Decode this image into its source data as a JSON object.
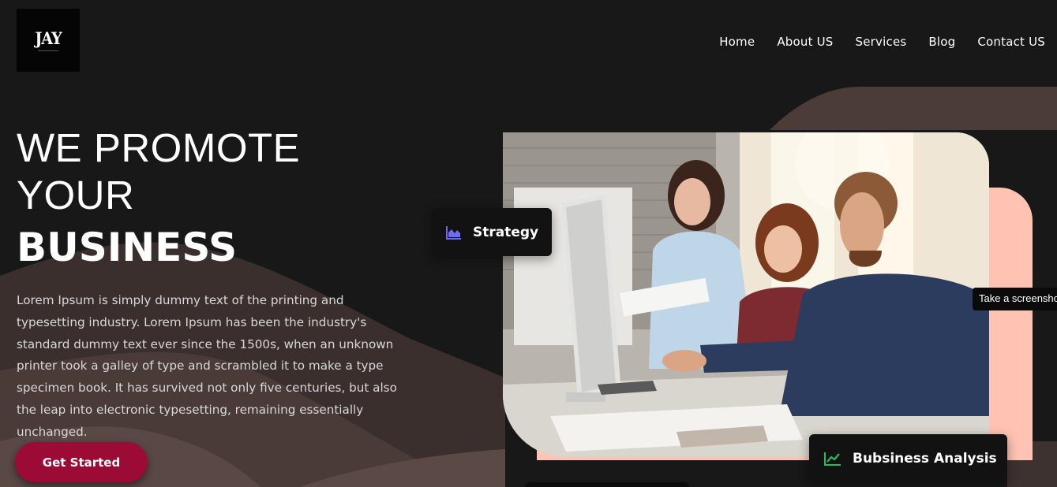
{
  "logo": {
    "text": "JAY",
    "alt": "JAY logo"
  },
  "nav": {
    "items": [
      {
        "label": "Home"
      },
      {
        "label": "About US"
      },
      {
        "label": "Services"
      },
      {
        "label": "Blog"
      },
      {
        "label": "Contact US"
      }
    ]
  },
  "hero": {
    "headline_line1": "WE PROMOTE YOUR",
    "headline_line2": "BUSINESS",
    "description": "Lorem Ipsum is simply dummy text of the printing and typesetting industry. Lorem Ipsum has been the industry's standard dummy text ever since the 1500s, when an unknown printer took a galley of type and scrambled it to make a type specimen book. It has survived not only five centuries, but also the leap into electronic typesetting, remaining essentially unchanged.",
    "cta_label": "Get Started"
  },
  "badges": {
    "strategy": {
      "label": "Strategy",
      "icon": "area-chart-icon",
      "icon_color": "#6c6cf5"
    },
    "analysis": {
      "label": "Bubsiness Analysis",
      "icon": "line-chart-icon",
      "icon_color": "#1fbf5c"
    }
  },
  "tooltip": {
    "text": "Take a screenshot"
  },
  "colors": {
    "background": "#181818",
    "accent": "#9c0b35",
    "pink_block": "#ffc3b4",
    "shape": "#4a3b39"
  }
}
